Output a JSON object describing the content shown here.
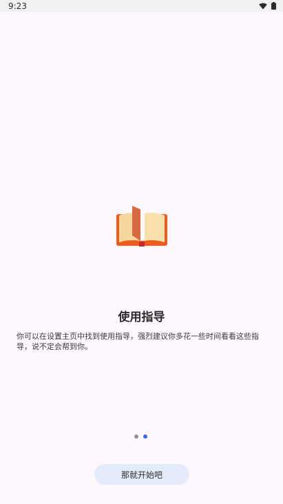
{
  "status_bar": {
    "time": "9:23",
    "icons": [
      "wifi-icon",
      "battery-icon"
    ]
  },
  "onboarding": {
    "illustration_icon": "open-book-icon",
    "title": "使用指导",
    "description": "你可以在设置主页中找到使用指导，强烈建议你多花一些时间看看这些指导，说不定会帮到你。",
    "page_indicator": {
      "total_pages": 2,
      "current_page": 2
    },
    "start_button_label": "那就开始吧"
  },
  "colors": {
    "background": "#fdf7fe",
    "indicator_active": "#3f66e6",
    "indicator_inactive": "#8d8d95",
    "button_background": "#e4ecfa",
    "book_cover": "#ef5a1f",
    "book_pages": "#f7d79c"
  }
}
